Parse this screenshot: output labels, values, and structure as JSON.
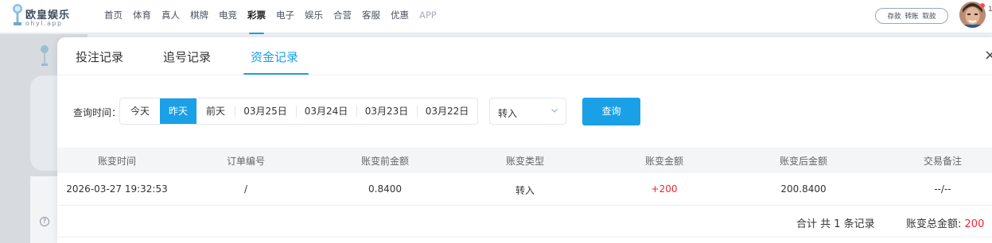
{
  "brand": {
    "name_cn": "欧皇娱乐",
    "domain": "ohyl.app"
  },
  "nav": {
    "items": [
      {
        "label": "首页",
        "state": "normal"
      },
      {
        "label": "体育",
        "state": "normal"
      },
      {
        "label": "真人",
        "state": "normal"
      },
      {
        "label": "棋牌",
        "state": "normal"
      },
      {
        "label": "电竞",
        "state": "normal"
      },
      {
        "label": "彩票",
        "state": "active"
      },
      {
        "label": "电子",
        "state": "normal"
      },
      {
        "label": "娱乐",
        "state": "normal"
      },
      {
        "label": "合营",
        "state": "normal"
      },
      {
        "label": "客服",
        "state": "normal"
      },
      {
        "label": "优惠",
        "state": "normal"
      },
      {
        "label": "APP",
        "state": "dim"
      }
    ]
  },
  "account": {
    "deposit": "存款",
    "transfer": "转账",
    "withdraw": "取款",
    "edge_text": "1"
  },
  "modal": {
    "tabs": [
      {
        "label": "投注记录",
        "active": false
      },
      {
        "label": "追号记录",
        "active": false
      },
      {
        "label": "资金记录",
        "active": true
      }
    ],
    "close": "×"
  },
  "query": {
    "label": "查询时间：",
    "dates": [
      {
        "label": "今天",
        "active": false
      },
      {
        "label": "昨天",
        "active": true
      },
      {
        "label": "前天",
        "active": false
      },
      {
        "label": "03月25日",
        "active": false
      },
      {
        "label": "03月24日",
        "active": false
      },
      {
        "label": "03月23日",
        "active": false
      },
      {
        "label": "03月22日",
        "active": false
      }
    ],
    "type_value": "转入",
    "search_button": "查询"
  },
  "table": {
    "columns": [
      "账变时间",
      "订单编号",
      "账变前金额",
      "账变类型",
      "账变金额",
      "账变后金额",
      "交易备注"
    ],
    "rows": [
      [
        "2026-03-27 19:32:53",
        "/",
        "0.8400",
        "转入",
        "+200",
        "200.8400",
        "--/--"
      ]
    ]
  },
  "summary": {
    "count_text": "合计 共 1 条记录",
    "total_label": "账变总金额:",
    "total_value": "200"
  },
  "colors": {
    "accent": "#1aa0e6",
    "positive_amount": "#f5222d"
  }
}
